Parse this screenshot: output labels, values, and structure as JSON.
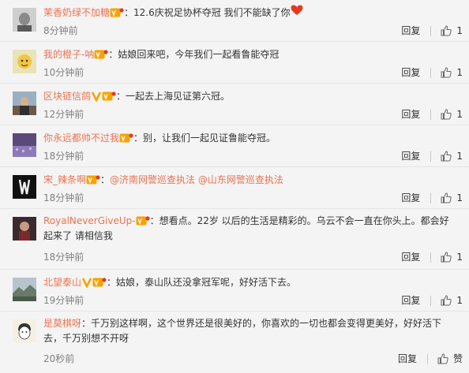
{
  "ui": {
    "reply_label": "回复",
    "colon": "："
  },
  "colors": {
    "username": "#eb7350",
    "text": "#333333",
    "time": "#808080",
    "border": "#e6e6e6",
    "background": "#f4f4f4"
  },
  "comments": [
    {
      "username": "茉香奶绿不加糖",
      "badges": [
        "vip-icon"
      ],
      "text": "12.6庆祝足协杯夺冠 我们不能缺了你",
      "emoji": "heart-icon",
      "time": "8分钟前",
      "reply": "回复",
      "likes": "1"
    },
    {
      "username": "我的橙子-呐",
      "badges": [
        "vip-icon"
      ],
      "text": "姑娘回来吧，今年我们一起看鲁能夺冠",
      "time": "10分钟前",
      "reply": "回复",
      "likes": "1"
    },
    {
      "username": "区块链信鸽",
      "badges": [
        "verified-v-icon",
        "vip-icon"
      ],
      "text": "一起去上海见证第六冠。",
      "time": "12分钟前",
      "reply": "回复",
      "likes": "1"
    },
    {
      "username": "你永远都帅不过我",
      "badges": [
        "vip-icon"
      ],
      "text": "别，让我们一起见证鲁能夺冠。",
      "time": "18分钟前",
      "reply": "回复",
      "likes": "1"
    },
    {
      "username": "宋_辣条啊",
      "badges": [
        "vip-icon"
      ],
      "mentions": [
        "@济南网警巡查执法",
        "@山东网警巡查执法"
      ],
      "time": "18分钟前",
      "reply": "回复",
      "likes": "1"
    },
    {
      "username": "RoyalNeverGiveUp-",
      "badges": [
        "vip-icon"
      ],
      "text": "想看点。22岁 以后的生活是精彩的。乌云不会一直在你头上。都会好起来了 请相信我",
      "time": "18分钟前",
      "reply": "回复",
      "likes": "1"
    },
    {
      "username": "北望泰山",
      "badges": [
        "verified-v-icon",
        "vip-icon"
      ],
      "text": "姑娘，泰山队还没拿冠军呢，好好活下去。",
      "time": "19分钟前",
      "reply": "回复",
      "likes": "1"
    },
    {
      "username": "是莫棋呀",
      "badges": [],
      "text": "千万别这样啊，这个世界还是很美好的，你喜欢的一切也都会变得更美好，好好活下去，千万别想不开呀",
      "time": "20秒前",
      "reply": "回复",
      "likes": "赞"
    }
  ]
}
